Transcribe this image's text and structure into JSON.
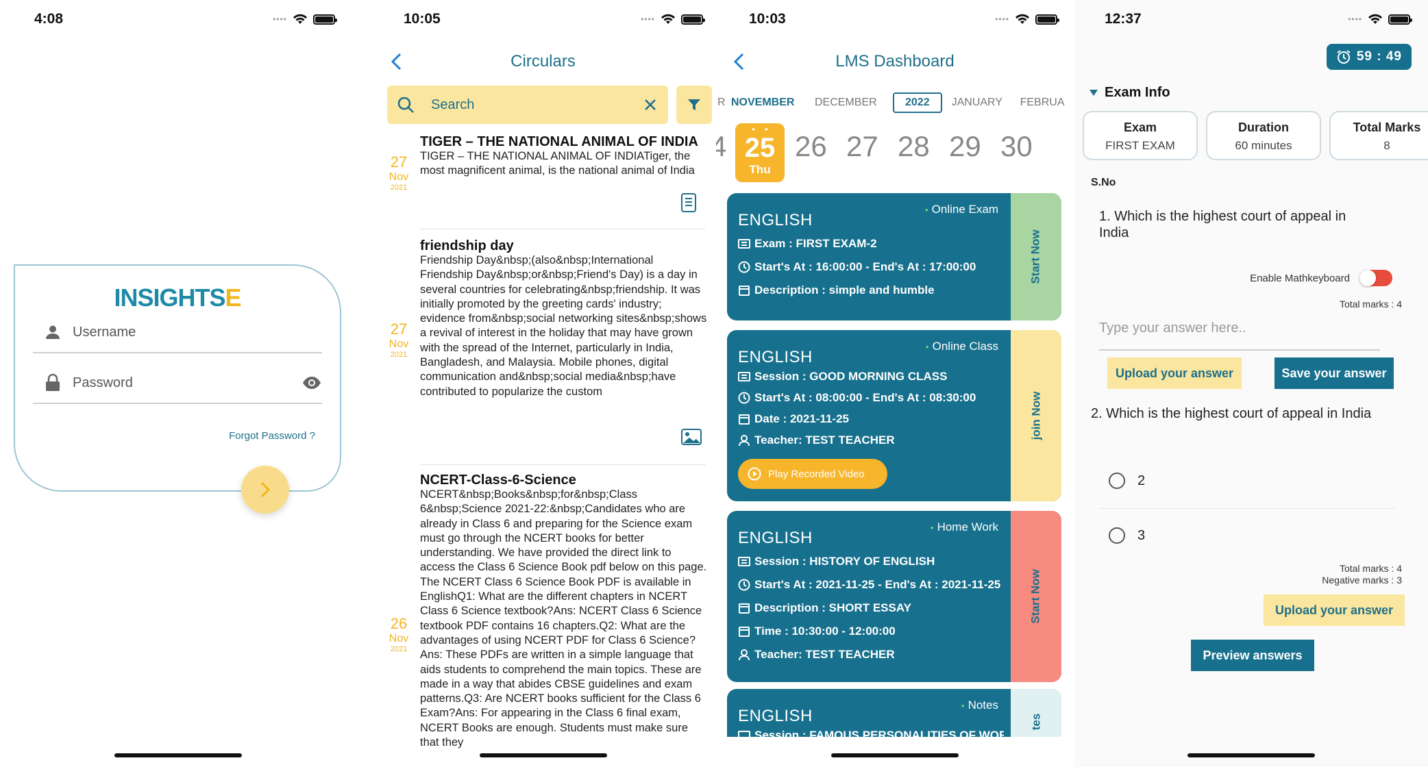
{
  "screens": {
    "login": {
      "time": "4:08",
      "logo_part1": "INSIGHTS",
      "logo_part2": "E",
      "username_label": "Username",
      "password_label": "Password",
      "forgot": "Forgot Password ?"
    },
    "circulars": {
      "time": "10:05",
      "title": "Circulars",
      "search_placeholder": "Search",
      "items": [
        {
          "day": "27",
          "month": "Nov",
          "year": "2021",
          "title": "TIGER – THE NATIONAL ANIMAL OF INDIA",
          "body": "TIGER – THE NATIONAL ANIMAL OF INDIATiger, the most magnificent animal, is the national animal of India"
        },
        {
          "day": "27",
          "month": "Nov",
          "year": "2021",
          "title": "friendship day",
          "body": "Friendship Day&nbsp;(also&nbsp;International Friendship Day&nbsp;or&nbsp;Friend's Day) is a day in several countries for celebrating&nbsp;friendship. It was initially promoted by the greeting cards' industry; evidence from&nbsp;social networking sites&nbsp;shows a revival of interest in the holiday that may have grown with the spread of the Internet, particularly in India, Bangladesh, and Malaysia. Mobile phones, digital communication and&nbsp;social media&nbsp;have contributed to popularize the custom"
        },
        {
          "day": "26",
          "month": "Nov",
          "year": "2021",
          "title": "NCERT-Class-6-Science",
          "body": "NCERT&nbsp;Books&nbsp;for&nbsp;Class 6&nbsp;Science 2021-22:&nbsp;Candidates who are already in Class 6 and preparing for the Science exam must go through the NCERT books for better understanding. We have provided the direct link to access the Class 6 Science Book pdf below on this page. The NCERT Class 6 Science Book PDF is available in EnglishQ1: What are the different chapters in NCERT Class 6 Science textbook?Ans: NCERT Class 6 Science textbook PDF contains 16 chapters.Q2: What are the advantages of using NCERT PDF for Class 6 Science?Ans: These PDFs are written in a simple language that aids students to comprehend the main topics. These are made in a way that abides CBSE guidelines and exam patterns.Q3: Are NCERT books sufficient for the Class 6 Exam?Ans: For appearing in the Class 6 final exam, NCERT Books are enough. Students must make sure that they"
        }
      ]
    },
    "lms": {
      "time": "10:03",
      "title": "LMS Dashboard",
      "months": [
        "R",
        "NOVEMBER",
        "DECEMBER",
        "2022",
        "JANUARY",
        "FEBRUA"
      ],
      "selected_day": "25",
      "selected_weekday": "Thu",
      "prev_day_fragment": "4",
      "days": [
        "26",
        "27",
        "28",
        "29",
        "30"
      ],
      "cards": [
        {
          "kind": "Online Exam",
          "subject": "ENGLISH",
          "action": "Start Now",
          "side_color": "#a8d5a2",
          "rows": [
            "Exam : FIRST EXAM-2",
            "Start's At : 16:00:00 - End's At : 17:00:00",
            "Description : simple and humble"
          ]
        },
        {
          "kind": "Online Class",
          "subject": "ENGLISH",
          "action": "join Now",
          "side_color": "#fbe6a0",
          "rows": [
            "Session : GOOD MORNING CLASS",
            "Start's At : 08:00:00 - End's At : 08:30:00",
            "Date : 2021-11-25",
            "Teacher: TEST TEACHER"
          ],
          "play_label": "Play Recorded Video"
        },
        {
          "kind": "Home Work",
          "subject": "ENGLISH",
          "action": "Start Now",
          "side_color": "#f78b80",
          "rows": [
            "Session : HISTORY OF ENGLISH",
            "Start's At : 2021-11-25 - End's At : 2021-11-25",
            "Description : SHORT ESSAY",
            "Time : 10:30:00 - 12:00:00",
            "Teacher: TEST TEACHER"
          ]
        },
        {
          "kind": "Notes",
          "subject": "ENGLISH",
          "action": "tes",
          "side_color": "#e1f1f1",
          "rows": [
            "Session : FAMOUS PERSONALITIES OF WOR"
          ]
        }
      ]
    },
    "exam": {
      "time": "12:37",
      "timer": "59 : 49",
      "section": "Exam Info",
      "info": [
        {
          "label": "Exam",
          "value": "FIRST EXAM"
        },
        {
          "label": "Duration",
          "value": "60 minutes"
        },
        {
          "label": "Total Marks",
          "value": "8"
        }
      ],
      "sno": "S.No",
      "q1": "1. Which is the highest court of appeal in India",
      "mathkb": "Enable Mathkeyboard",
      "q1_marks": "Total marks : 4",
      "answer_placeholder": "Type your answer here..",
      "upload": "Upload your answer",
      "save": "Save your answer",
      "q2": "2. Which is the highest court of appeal in India",
      "options": [
        "2",
        "3"
      ],
      "q2_marks": "Total marks : 4",
      "q2_neg": "Negative marks : 3",
      "upload2": "Upload your answer",
      "preview": "Preview answers"
    }
  }
}
